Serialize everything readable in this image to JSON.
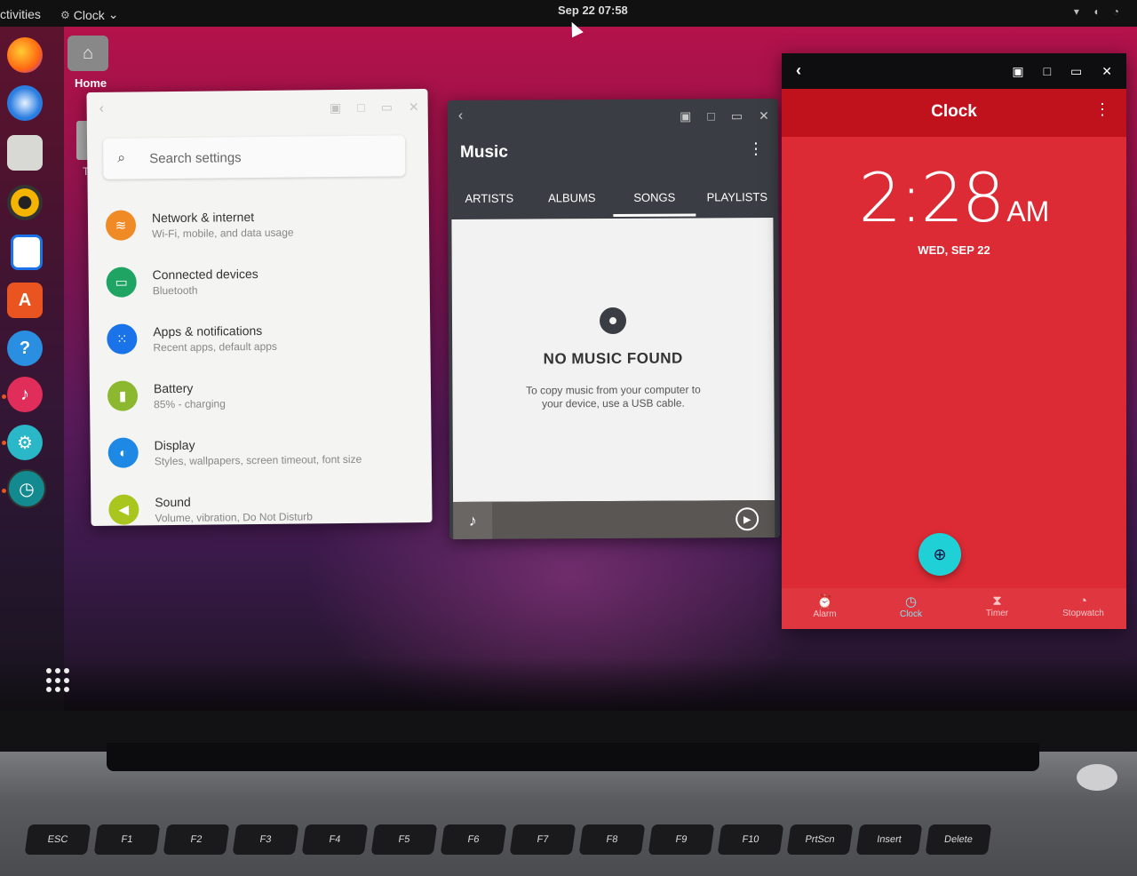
{
  "topbar": {
    "activities": "ctivities",
    "app_menu": "Clock",
    "datetime": "Sep 22  07:58"
  },
  "desktop": {
    "home_label": "Home",
    "trash_label": "Tr"
  },
  "settings": {
    "search_placeholder": "Search settings",
    "items": [
      {
        "title": "Network & internet",
        "subtitle": "Wi-Fi, mobile, and data usage",
        "icon": "wifi-icon",
        "color": "#f08a24"
      },
      {
        "title": "Connected devices",
        "subtitle": "Bluetooth",
        "icon": "devices-icon",
        "color": "#1fa463"
      },
      {
        "title": "Apps & notifications",
        "subtitle": "Recent apps, default apps",
        "icon": "apps-icon",
        "color": "#1a73e8"
      },
      {
        "title": "Battery",
        "subtitle": "85% - charging",
        "icon": "battery-icon",
        "color": "#8bb82f"
      },
      {
        "title": "Display",
        "subtitle": "Styles, wallpapers, screen timeout, font size",
        "icon": "display-icon",
        "color": "#1e88e5"
      },
      {
        "title": "Sound",
        "subtitle": "Volume, vibration, Do Not Disturb",
        "icon": "sound-icon",
        "color": "#a8c61e"
      }
    ]
  },
  "music": {
    "title": "Music",
    "tabs": [
      "ARTISTS",
      "ALBUMS",
      "SONGS",
      "PLAYLISTS"
    ],
    "active_tab": "SONGS",
    "empty_title": "NO MUSIC FOUND",
    "empty_message": "To copy music from your computer to your device, use a USB cable."
  },
  "clock": {
    "title": "Clock",
    "time": "2:28",
    "ampm": "AM",
    "date": "WED, SEP 22",
    "nav": [
      {
        "label": "Alarm",
        "icon": "alarm-icon"
      },
      {
        "label": "Clock",
        "icon": "clock-icon"
      },
      {
        "label": "Timer",
        "icon": "timer-icon"
      },
      {
        "label": "Stopwatch",
        "icon": "stopwatch-icon"
      }
    ],
    "active_nav": "Clock",
    "accent": "#dc2b35",
    "fab_color": "#1fd0d6"
  },
  "keyboard": {
    "row1": [
      "ESC",
      "F1",
      "F2",
      "F3",
      "F4",
      "F5",
      "F6",
      "F7",
      "F8",
      "F9",
      "F10",
      "PrtScn",
      "Insert",
      "Delete"
    ]
  }
}
